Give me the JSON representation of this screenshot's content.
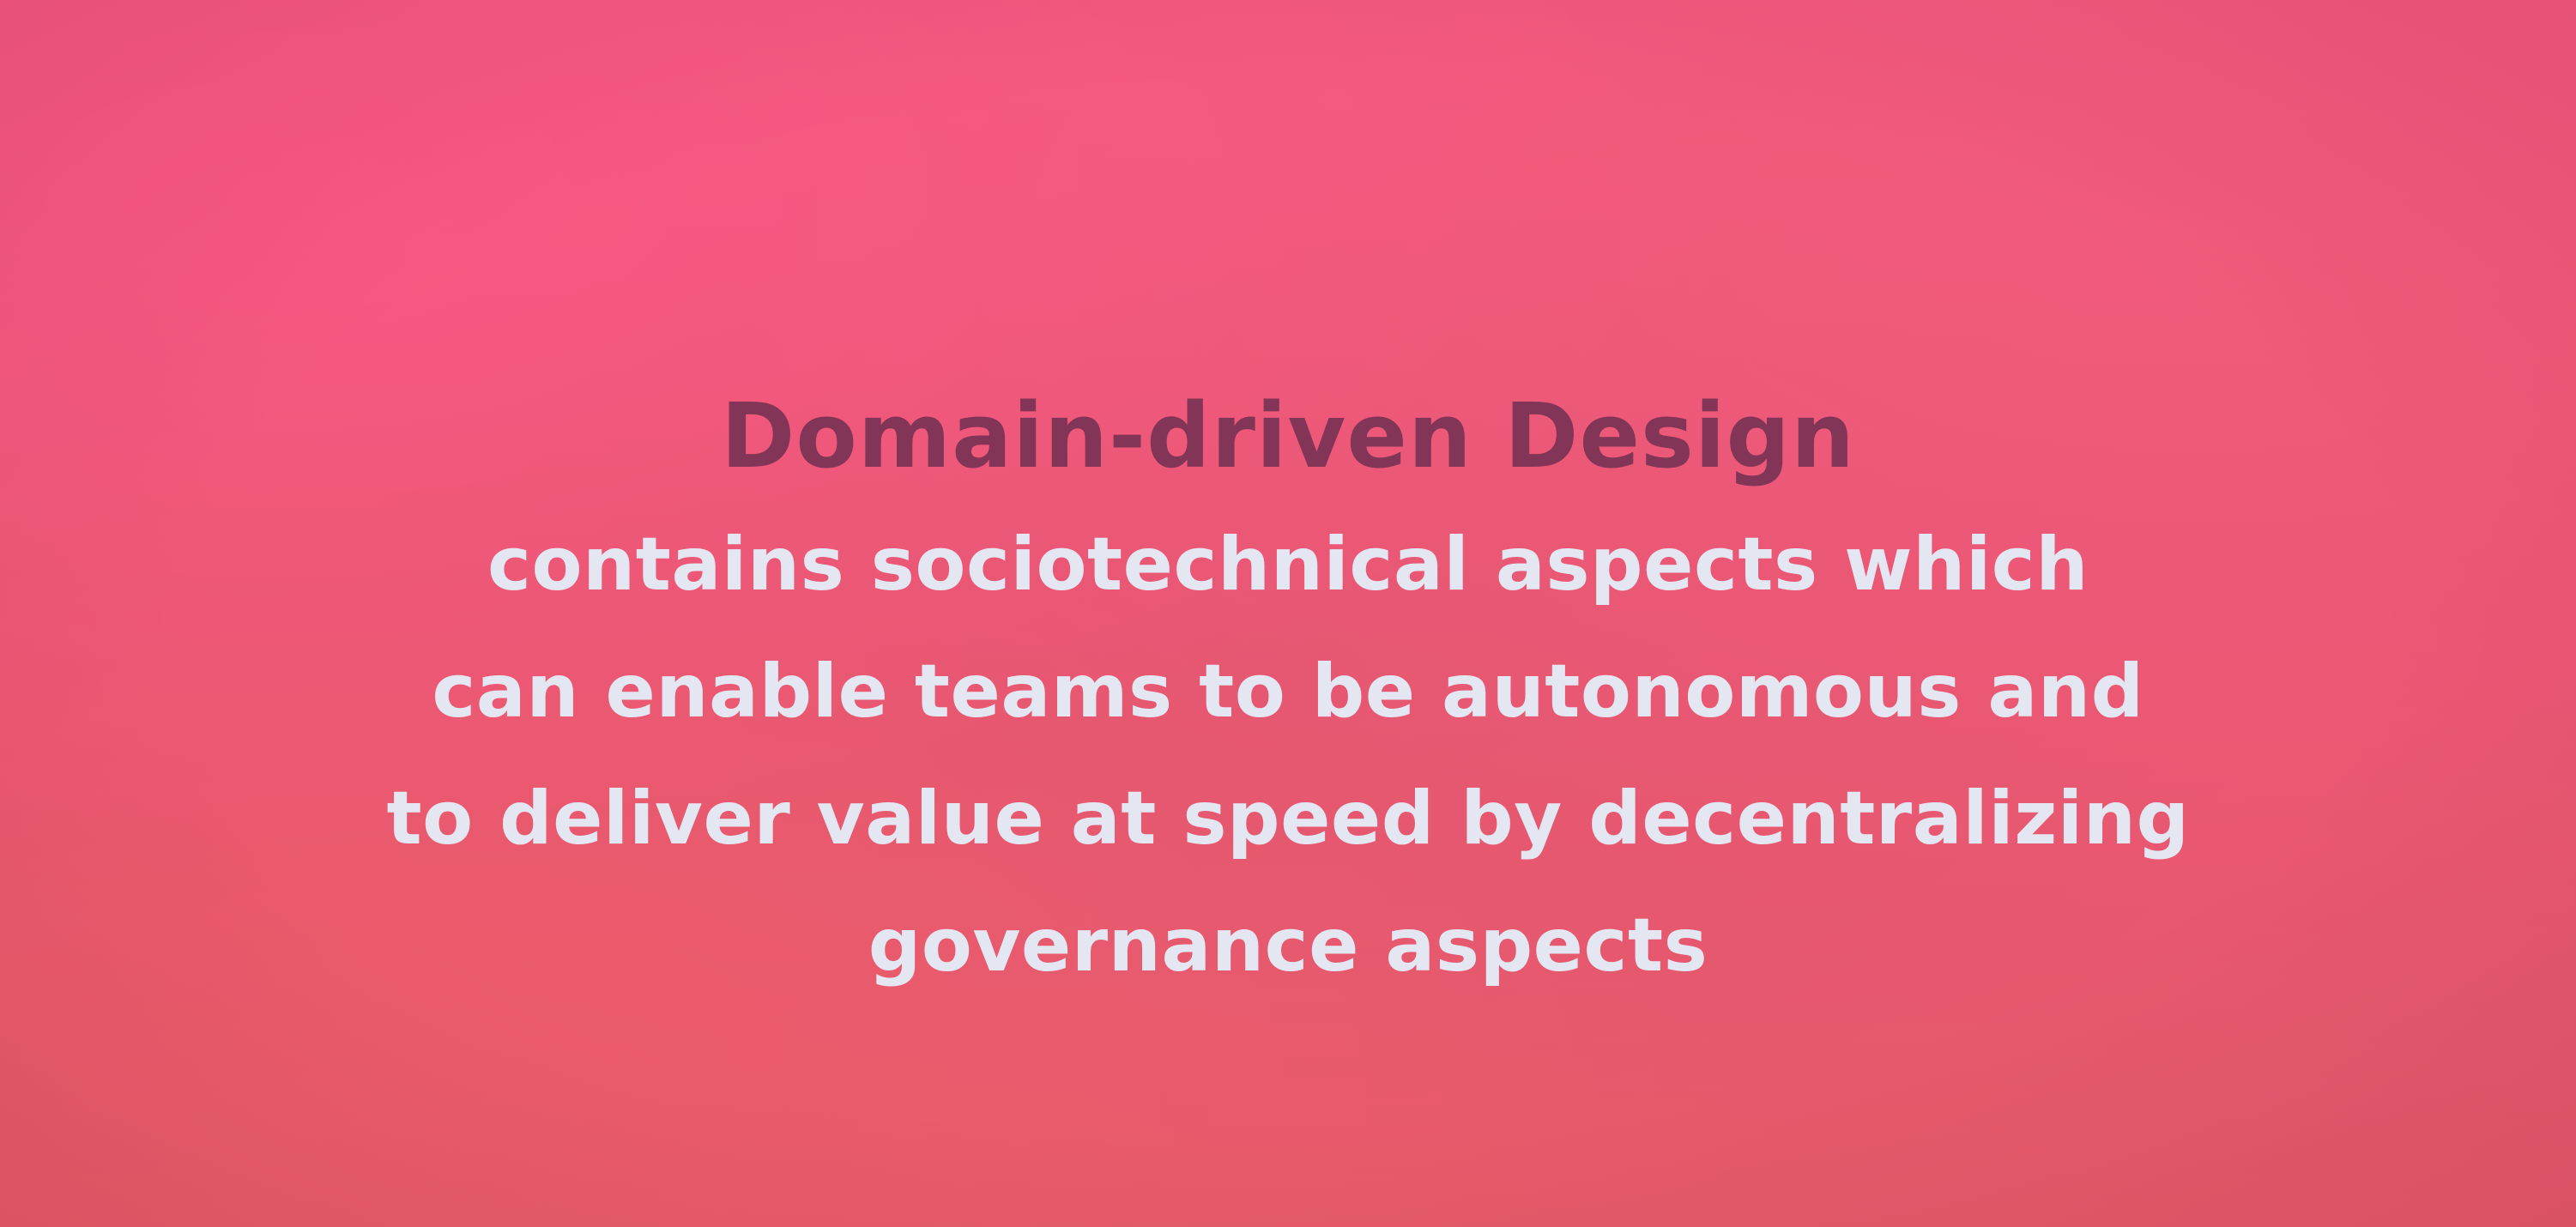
{
  "slide": {
    "title": "Domain-driven Design",
    "body_lines": [
      "contains sociotechnical aspects which",
      "can enable teams to be autonomous and",
      "to deliver value at speed by decentralizing",
      "governance aspects"
    ]
  },
  "colors": {
    "background": "#ea5774",
    "title": "#7d3456",
    "body_text": "#e4e6f2"
  }
}
